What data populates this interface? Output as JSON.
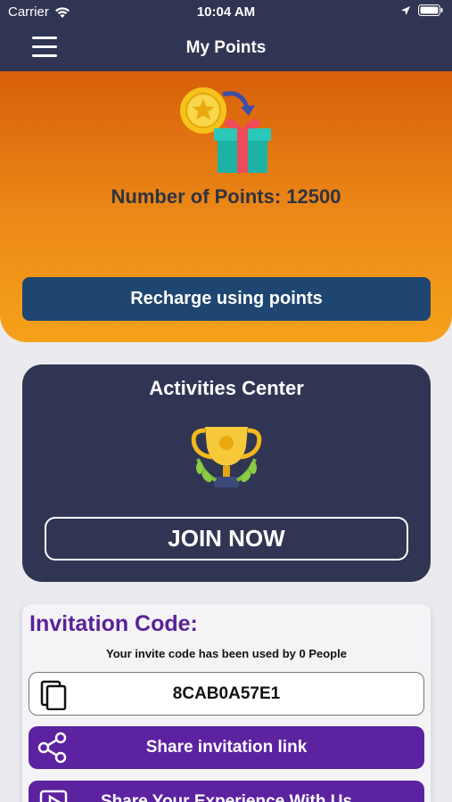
{
  "status_bar": {
    "carrier": "Carrier",
    "time": "10:04 AM"
  },
  "nav": {
    "title": "My Points",
    "menu_icon": "hamburger-menu-icon"
  },
  "points": {
    "label": "Number of Points: 12500",
    "recharge_label": "Recharge using points"
  },
  "activities": {
    "title": "Activities Center",
    "join_label": "JOIN NOW"
  },
  "invitation": {
    "heading": "Invitation Code:",
    "used_text": "Your invite code has been used by 0 People",
    "code": "8CAB0A57E1",
    "share_label": "Share invitation link",
    "experience_label": "Share Your Experience With Us"
  },
  "colors": {
    "nav_bg": "#303553",
    "orange_top": "#d85f0a",
    "orange_bottom": "#f5a21a",
    "recharge_btn": "#1e4670",
    "purple": "#5c22a0",
    "heading_purple": "#5a2294"
  }
}
